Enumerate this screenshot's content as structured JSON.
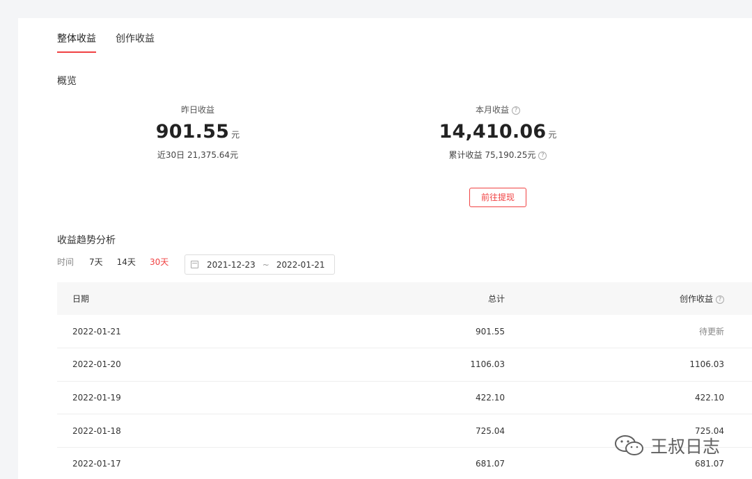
{
  "tabs": [
    {
      "label": "整体收益",
      "active": true
    },
    {
      "label": "创作收益",
      "active": false
    }
  ],
  "overview": {
    "title": "概览",
    "yesterday": {
      "label": "昨日收益",
      "value": "901.55",
      "unit": "元",
      "sub": "近30日 21,375.64元"
    },
    "month": {
      "label": "本月收益",
      "value": "14,410.06",
      "unit": "元",
      "sub": "累计收益 75,190.25元"
    },
    "withdraw_label": "前往提现",
    "help_icon": "?"
  },
  "trend": {
    "title": "收益趋势分析",
    "time_label": "时间",
    "options": [
      {
        "label": "7天",
        "active": false
      },
      {
        "label": "14天",
        "active": false
      },
      {
        "label": "30天",
        "active": true
      }
    ],
    "date_start": "2021-12-23",
    "date_sep": "~",
    "date_end": "2022-01-21"
  },
  "table": {
    "headers": {
      "date": "日期",
      "total": "总计",
      "creation": "创作收益"
    },
    "rows": [
      {
        "date": "2022-01-21",
        "total": "901.55",
        "creation": "待更新"
      },
      {
        "date": "2022-01-20",
        "total": "1106.03",
        "creation": "1106.03"
      },
      {
        "date": "2022-01-19",
        "total": "422.10",
        "creation": "422.10"
      },
      {
        "date": "2022-01-18",
        "total": "725.04",
        "creation": "725.04"
      },
      {
        "date": "2022-01-17",
        "total": "681.07",
        "creation": "681.07"
      }
    ]
  },
  "watermark": {
    "text": "王叔日志",
    "icon": "wechat-icon"
  },
  "colors": {
    "accent": "#f04142",
    "background": "#f4f5f7"
  }
}
